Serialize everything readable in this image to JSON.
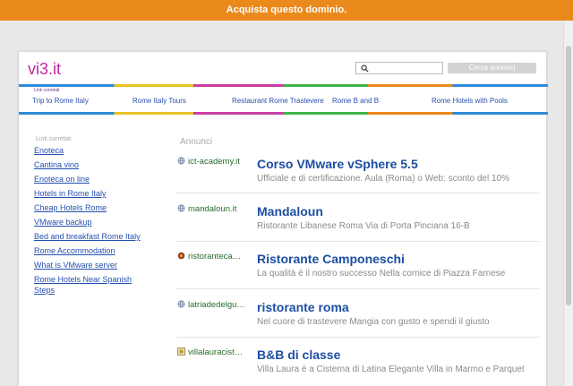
{
  "topbar": {
    "label": "Acquista questo dominio."
  },
  "site": {
    "logo": "vi3.it"
  },
  "search": {
    "placeholder": "",
    "button_label": "Cerca annunci"
  },
  "related": {
    "title": "Link correlati",
    "links": [
      "Trip to Rome Italy",
      "Rome Italy Tours",
      "Restaurant Rome Trastevere",
      "Rome B and B",
      "Rome Hotels with Pools"
    ]
  },
  "sidebar": {
    "title": "Link correlati",
    "links": [
      "Enoteca",
      "Cantina vino",
      "Enoteca on line",
      "Hotels in Rome Italy",
      "Cheap Hotels Rome",
      "VMware backup",
      "Bed and breakfast Rome Italy",
      "Rome Accommodation",
      "What is VMware server",
      "Rome Hotels Near Spanish Steps"
    ]
  },
  "ads": {
    "title": "Annunci",
    "items": [
      {
        "domain": "ict-academy.it",
        "icon": "globe-icon",
        "title": "Corso VMware vSphere 5.5",
        "desc": "Ufficiale e di certificazione. Aula (Roma) o Web: sconto del 10%"
      },
      {
        "domain": "mandaloun.it",
        "icon": "globe-icon",
        "title": "Mandaloun",
        "desc": "Ristorante Libanese Roma Via di Porta Pinciana 16-B"
      },
      {
        "domain": "ristoranteca…",
        "icon": "restaurant-favicon-icon",
        "title": "Ristorante Camponeschi",
        "desc": "La qualità è il nostro successo Nella cornice di Piazza Farnese"
      },
      {
        "domain": "latriadedelgu…",
        "icon": "globe-icon",
        "title": "ristorante roma",
        "desc": "Nel cuore di trastevere Mangia con gusto e spendi il giusto"
      },
      {
        "domain": "villalauracist…",
        "icon": "villa-favicon-icon",
        "title": "B&B di classe",
        "desc": "Villa Laura è a Cisterna di Latina Elegante Villa in Marmo e Parquet"
      }
    ]
  }
}
